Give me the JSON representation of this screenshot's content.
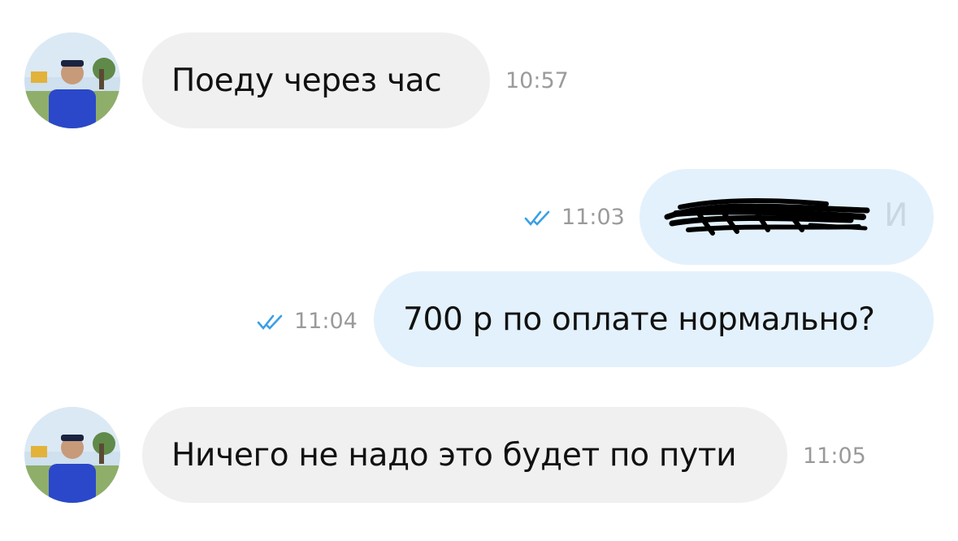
{
  "messages": [
    {
      "direction": "incoming",
      "text": "Поеду через час",
      "time": "10:57"
    },
    {
      "direction": "outgoing",
      "text": "И",
      "time": "11:03",
      "redacted": true,
      "status": "read"
    },
    {
      "direction": "outgoing",
      "text": "700 р по оплате нормально?",
      "time": "11:04",
      "status": "read"
    },
    {
      "direction": "incoming",
      "text": "Ничего не надо это будет по пути",
      "time": "11:05"
    }
  ],
  "icons": {
    "read_status": "double-check-icon",
    "avatar": "contact-avatar-photo"
  },
  "colors": {
    "incoming_bubble": "#f0f0f0",
    "outgoing_bubble": "#e3f1fc",
    "check_blue": "#3a9fe6",
    "time_gray": "#9a9a9a"
  }
}
